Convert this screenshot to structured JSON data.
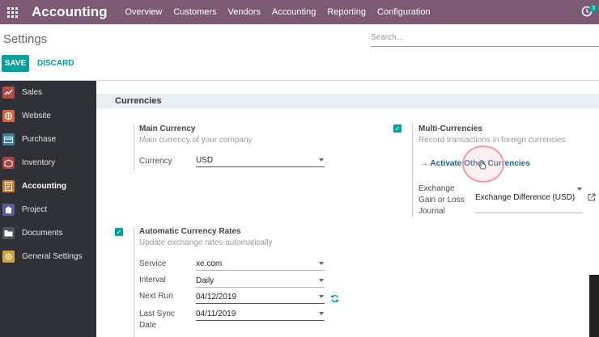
{
  "navbar": {
    "brand": "Accounting",
    "menu": [
      "Overview",
      "Customers",
      "Vendors",
      "Accounting",
      "Reporting",
      "Configuration"
    ],
    "activity_badge": "3"
  },
  "control": {
    "title": "Settings",
    "search_placeholder": "Search...",
    "save": "SAVE",
    "discard": "DISCARD"
  },
  "sidebar": {
    "items": [
      {
        "label": "Sales",
        "icon": "chart-icon",
        "color": "#b44a4a"
      },
      {
        "label": "Website",
        "icon": "globe-icon",
        "color": "#d9663a"
      },
      {
        "label": "Purchase",
        "icon": "card-icon",
        "color": "#3d7ea6"
      },
      {
        "label": "Inventory",
        "icon": "box-icon",
        "color": "#a8423f"
      },
      {
        "label": "Accounting",
        "icon": "accounting-icon",
        "color": "#d07b32"
      },
      {
        "label": "Project",
        "icon": "puzzle-icon",
        "color": "#5f5a9a"
      },
      {
        "label": "Documents",
        "icon": "folder-icon",
        "color": "#4b5561"
      },
      {
        "label": "General Settings",
        "icon": "gear-icon",
        "color": "#d0a23a"
      }
    ],
    "active_index": 4
  },
  "section": {
    "title": "Currencies",
    "main_currency": {
      "title": "Main Currency",
      "desc": "Main currency of your company",
      "label": "Currency",
      "value": "USD"
    },
    "multi_currency": {
      "checked": true,
      "title": "Multi-Currencies",
      "desc": "Record transactions in foreign currencies",
      "link": "Activate Other Currencies",
      "exchange_label_1": "Exchange",
      "exchange_label_2": "Gain or Loss",
      "exchange_label_3": "Journal",
      "exchange_value": "Exchange Difference (USD)"
    },
    "auto_rates": {
      "checked": true,
      "title": "Automatic Currency Rates",
      "desc": "Update exchange rates automatically",
      "service_label": "Service",
      "service_value": "xe.com",
      "interval_label": "Interval",
      "interval_value": "Daily",
      "next_run_label": "Next Run",
      "next_run_value": "04/12/2019",
      "last_sync_label_1": "Last Sync",
      "last_sync_label_2": "Date",
      "last_sync_value": "04/11/2019"
    }
  },
  "colors": {
    "navbar": "#7c5a73",
    "accent": "#00a09d",
    "sidebar": "#2f3136"
  }
}
